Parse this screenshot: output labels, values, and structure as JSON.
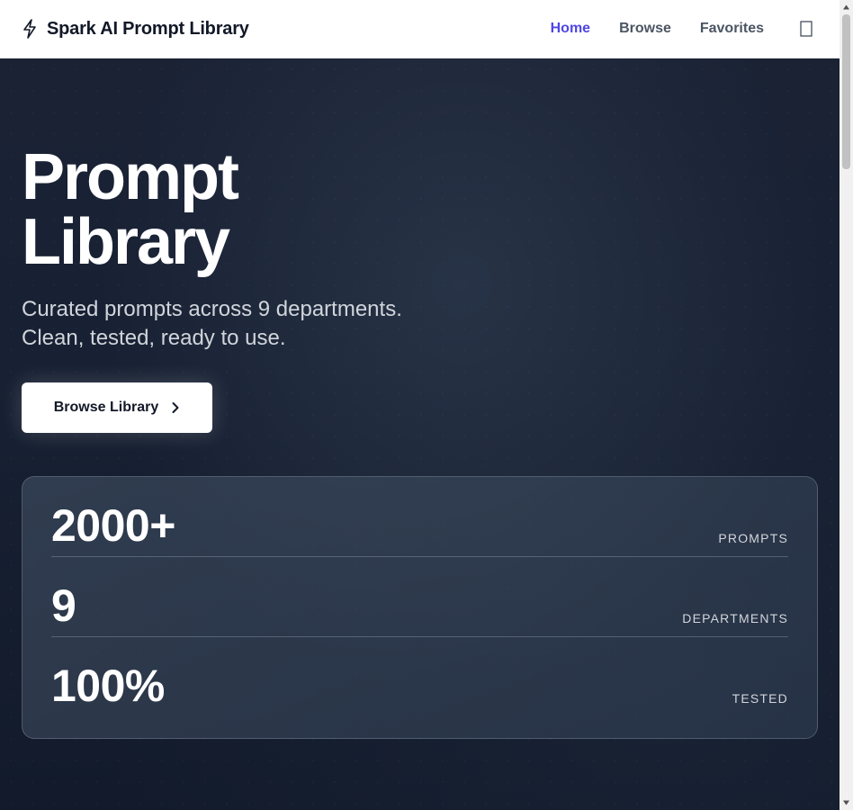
{
  "header": {
    "brand_title": "Spark AI Prompt Library",
    "brand_icon": "lightning-icon",
    "nav": [
      {
        "label": "Home",
        "active": true
      },
      {
        "label": "Browse",
        "active": false
      },
      {
        "label": "Favorites",
        "active": false
      }
    ],
    "theme_toggle_icon": "moon-icon",
    "active_color": "#4f46e5"
  },
  "hero": {
    "title_line1": "Prompt",
    "title_line2": "Library",
    "subtitle_line1": "Curated prompts across 9 departments.",
    "subtitle_line2": "Clean, tested, ready to use.",
    "cta_label": "Browse Library",
    "cta_icon": "chevron-right-icon"
  },
  "stats": [
    {
      "value": "2000+",
      "label": "PROMPTS"
    },
    {
      "value": "9",
      "label": "DEPARTMENTS"
    },
    {
      "value": "100%",
      "label": "TESTED"
    }
  ]
}
